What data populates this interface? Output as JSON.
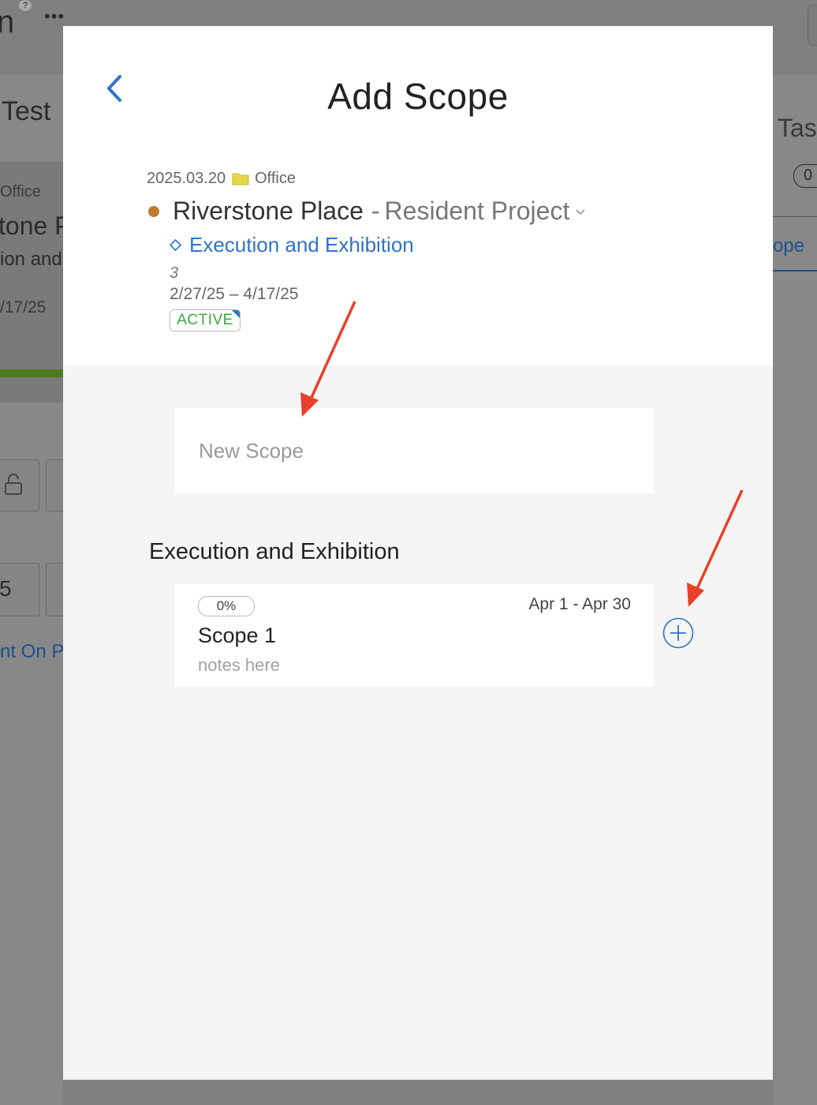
{
  "background": {
    "fragments": {
      "top_left_glyph": "n",
      "help_mark": "?",
      "dots": "•••",
      "test_label": "Test",
      "office_label": "Office",
      "project_fragment": "tone P",
      "phase_fragment": "ion and",
      "date_fragment": "/17/25",
      "number_fragment": "5",
      "link_fragment": "nt On P",
      "tasks_fragment": "Tas",
      "zero_badge": "0",
      "scope_tab_fragment": "ope"
    }
  },
  "modal": {
    "title": "Add Scope",
    "back_icon": "chevron-left-icon",
    "project": {
      "date": "2025.03.20",
      "folder_icon": "folder-icon",
      "folder": "Office",
      "status_color": "#c07a2e",
      "name": "Riverstone Place",
      "separator": "-",
      "subtitle": "Resident Project",
      "phase": "Execution and Exhibition",
      "count": "3",
      "date_range": "2/27/25 – 4/17/25",
      "status": "ACTIVE"
    },
    "new_scope": {
      "placeholder": "New Scope",
      "value": ""
    },
    "section": {
      "heading": "Execution and Exhibition",
      "scopes": [
        {
          "progress": "0%",
          "dates": "Apr 1 - Apr 30",
          "title": "Scope 1",
          "notes": "notes here"
        }
      ]
    },
    "add_icon": "plus-circle-icon"
  },
  "colors": {
    "accent": "#2f73c9",
    "active_green": "#3aa83a",
    "annotation_red": "#e8402a"
  }
}
